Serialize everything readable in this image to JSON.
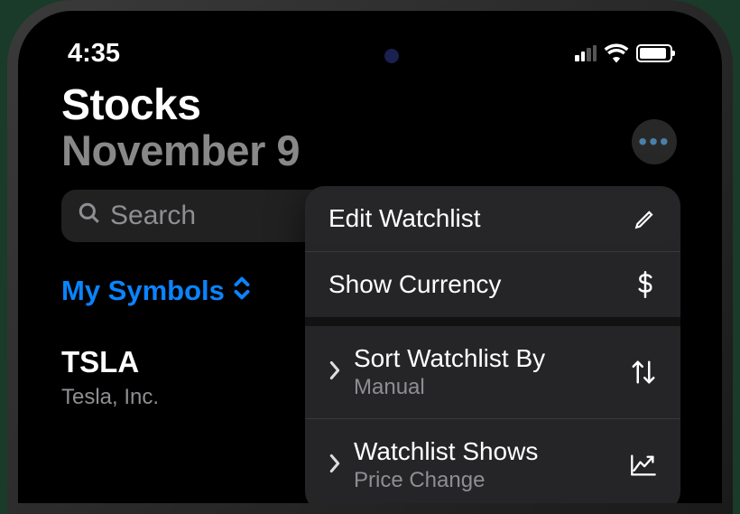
{
  "status": {
    "time": "4:35"
  },
  "header": {
    "title": "Stocks",
    "date": "November 9"
  },
  "search": {
    "placeholder": "Search"
  },
  "watchlist": {
    "selected_name": "My Symbols"
  },
  "stocks": [
    {
      "symbol": "TSLA",
      "name": "Tesla, Inc."
    }
  ],
  "menu": {
    "items": [
      {
        "label": "Edit Watchlist",
        "icon": "pencil"
      },
      {
        "label": "Show Currency",
        "icon": "dollar"
      },
      {
        "label": "Sort Watchlist By",
        "sublabel": "Manual",
        "icon": "sort",
        "submenu": true
      },
      {
        "label": "Watchlist Shows",
        "sublabel": "Price Change",
        "icon": "chart",
        "submenu": true
      }
    ]
  }
}
